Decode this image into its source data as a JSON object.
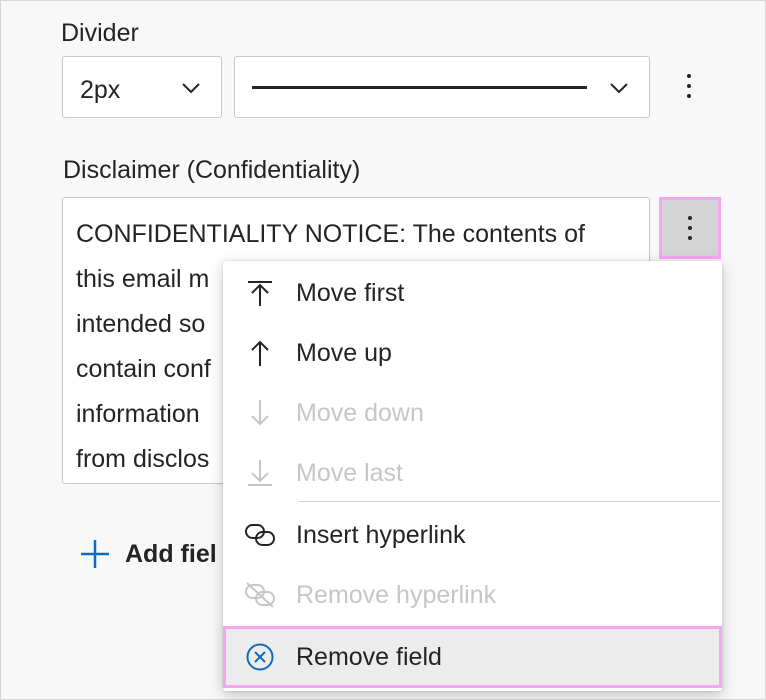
{
  "divider": {
    "label": "Divider",
    "size_value": "2px"
  },
  "disclaimer": {
    "label": "Disclaimer (Confidentiality)",
    "text_lines": [
      "CONFIDENTIALITY NOTICE: The contents of",
      "this email m",
      "intended so",
      "contain conf",
      "information",
      "from disclos"
    ]
  },
  "add_field": {
    "label": "Add fiel"
  },
  "menu": {
    "items": [
      {
        "label": "Move first",
        "icon": "arrow-to-top-icon",
        "enabled": true
      },
      {
        "label": "Move up",
        "icon": "arrow-up-icon",
        "enabled": true
      },
      {
        "label": "Move down",
        "icon": "arrow-down-icon",
        "enabled": false
      },
      {
        "label": "Move last",
        "icon": "arrow-to-bottom-icon",
        "enabled": false
      },
      {
        "label": "Insert hyperlink",
        "icon": "link-icon",
        "enabled": true
      },
      {
        "label": "Remove hyperlink",
        "icon": "link-remove-icon",
        "enabled": false
      },
      {
        "label": "Remove field",
        "icon": "dismiss-circle-icon",
        "enabled": true
      }
    ]
  },
  "colors": {
    "highlight_border": "#f5a6f0",
    "accent_blue": "#0f6cbd",
    "disabled_text": "#c6c6c6"
  }
}
